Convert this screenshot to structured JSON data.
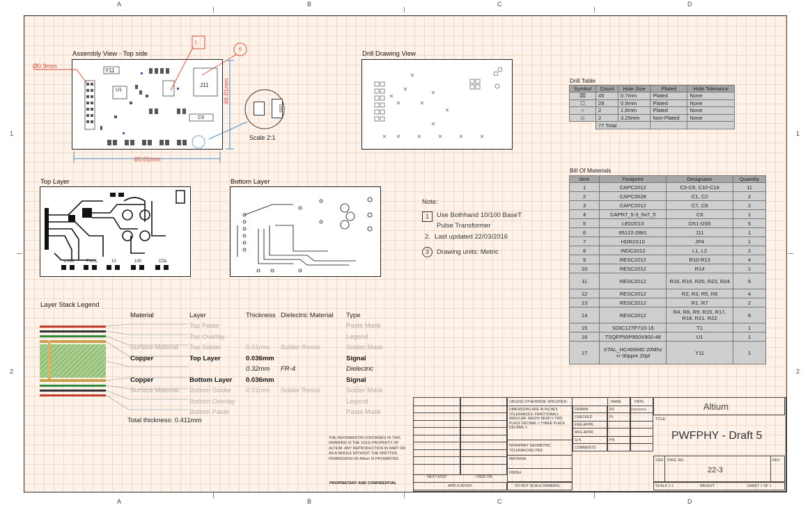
{
  "zones": {
    "letters": [
      "A",
      "B",
      "C",
      "D"
    ],
    "numbers": [
      "1",
      "2"
    ]
  },
  "views": {
    "assembly_title": "Assembly View - Top side",
    "drill_drawing_title": "Drill Drawing View",
    "top_layer_title": "Top Layer",
    "bottom_layer_title": "Bottom Layer",
    "layer_stack_title": "Layer Stack Legend"
  },
  "assembly": {
    "hole_dim": "Ø0.9mm",
    "height_dim": "48.01mm",
    "width_dim": "80.01mm",
    "scale": "Scale 2:1",
    "callout_1": "1",
    "callout_6": "6",
    "labels": {
      "y11": "Y11",
      "u1": "U1",
      "j11": "J11",
      "c9": "C9"
    },
    "detail_label": "DS5"
  },
  "top_layer_labels": [
    "LINK",
    "FULL",
    "10",
    "100",
    "COL"
  ],
  "note": {
    "title": "Note:",
    "items": [
      {
        "marker": "1",
        "text_line1": "Use Bothhand 10/100 BaseT",
        "text_line2": "Pulse Transformer"
      },
      {
        "marker": "2.",
        "text_line1": "Last updated 22/03/2016"
      },
      {
        "marker": "3",
        "text_line1": "Drawing units: Metric"
      }
    ]
  },
  "drill_table": {
    "title": "Drill Table",
    "headers": [
      "Symbol",
      "Count",
      "Hole Size",
      "Plated",
      "Hole Tolerance"
    ],
    "rows": [
      [
        "⌧",
        "45",
        "0.7mm",
        "Plated",
        "None"
      ],
      [
        "☐",
        "28",
        "0.9mm",
        "Plated",
        "None"
      ],
      [
        "○",
        "2",
        "1.6mm",
        "Plated",
        "None"
      ],
      [
        "◇",
        "2",
        "3.25mm",
        "Non-Plated",
        "None"
      ]
    ],
    "total": "77 Total"
  },
  "bom": {
    "title": "Bill Of Materials",
    "headers": [
      "Item",
      "Footprint",
      "Designator",
      "Quantity"
    ],
    "rows": [
      [
        "1",
        "CAPC2012",
        "C3-C6, C10-C16",
        "11"
      ],
      [
        "2",
        "CAPC3528",
        "C1, C2",
        "2"
      ],
      [
        "3",
        "CAPC2012",
        "C7, C8",
        "2"
      ],
      [
        "4",
        "CAPR7_5-3_6x7_5",
        "C9",
        "1"
      ],
      [
        "5",
        "LED2013",
        "DS1-DS5",
        "5"
      ],
      [
        "6",
        "95122-2881",
        "J11",
        "1"
      ],
      [
        "7",
        "HDR2X10",
        "JP4",
        "1"
      ],
      [
        "8",
        "INDC2012",
        "L1, L2",
        "2"
      ],
      [
        "9",
        "RESC2012",
        "R10-R13",
        "4"
      ],
      [
        "10",
        "RESC2012",
        "R14",
        "1"
      ],
      [
        "11",
        "RESC2012",
        "R16, R19, R20, R23, R24",
        "5"
      ],
      [
        "12",
        "RESC2012",
        "R2, R3, R5, R6",
        "4"
      ],
      [
        "13",
        "RESC2012",
        "R1, R7",
        "2"
      ],
      [
        "14",
        "RESC2012",
        "R4, R8, R9, R15, R17, R18, R21, R22",
        "8"
      ],
      [
        "15",
        "SOIC127P710-16",
        "T1",
        "1"
      ],
      [
        "16",
        "TSQFP50P900X900-48",
        "U1",
        "1"
      ],
      [
        "17",
        "XTAL_HC49SMD 20Mhz +/-30ppm 20pf",
        "Y11",
        "1"
      ]
    ]
  },
  "layer_stack": {
    "headers": {
      "material": "Material",
      "layer": "Layer",
      "thickness": "Thickness",
      "dielectric": "Dielectric Material",
      "type": "Type"
    },
    "rows": [
      {
        "material": "",
        "layer": "Top Paste",
        "thickness": "",
        "dielectric": "",
        "type": "Paste Mask",
        "style": "grey"
      },
      {
        "material": "",
        "layer": "Top Overlay",
        "thickness": "",
        "dielectric": "",
        "type": "Legend",
        "style": "grey"
      },
      {
        "material": "Surface Material",
        "layer": "Top Solder",
        "thickness": "0.01mm",
        "dielectric": "Solder Resist",
        "type": "Solder Mask",
        "style": "grey"
      },
      {
        "material": "Copper",
        "layer": "Top Layer",
        "thickness": "0.036mm",
        "dielectric": "",
        "type": "Signal",
        "style": "bold"
      },
      {
        "material": "",
        "layer": "",
        "thickness": "0.32mm",
        "dielectric": "FR-4",
        "type": "Dielectric",
        "style": "ital"
      },
      {
        "material": "Copper",
        "layer": "Bottom Layer",
        "thickness": "0.036mm",
        "dielectric": "",
        "type": "Signal",
        "style": "bold"
      },
      {
        "material": "Surface Material",
        "layer": "Bottom Solder",
        "thickness": "0.01mm",
        "dielectric": "Solder Resist",
        "type": "Solder Mask",
        "style": "grey"
      },
      {
        "material": "",
        "layer": "Bottom Overlay",
        "thickness": "",
        "dielectric": "",
        "type": "Legend",
        "style": "grey"
      },
      {
        "material": "",
        "layer": "Bottom Paste",
        "thickness": "",
        "dielectric": "",
        "type": "Paste Mask",
        "style": "grey"
      }
    ],
    "total": "Total thickness: 0.411mm"
  },
  "title_block": {
    "disclaimer": "THE INFORMATION CONTAINED IN THIS DRAWING IS THE SOLE PROPERTY OF ALTIUM. ANY REPRODUCTION IN PART OR AS A WHOLE WITHOUT THE WRITTEN PERMISSION OF Altium IS PROHIBITED.",
    "proprietary": "PROPRIETARY AND CONFIDENTIAL",
    "next_assy": "NEXT ASSY",
    "used_on": "USED ON",
    "application": "APPLICATION",
    "do_not_scale": "DO NOT SCALE DRAWING",
    "unless": "UNLESS OTHERWISE SPECIFIED:",
    "dimensions": "DIMENSIONS ARE IN INCHES TOLERANCES: FRACTIONAL± ANGULAR: MACH± BEND ± TWO PLACE DECIMAL ± THREE PLACE DECIMAL ±",
    "interpret": "INTERPRET GEOMETRIC TOLERANCING PER:",
    "material": "MATERIAL",
    "finish": "FINISH",
    "name_h": "NAME",
    "date_h": "DATE",
    "drawn": "DRAWN",
    "drawn_name": "RS",
    "drawn_date": "22/03/2016",
    "checked": "CHECKED",
    "checked_name": "PL",
    "eng_appr": "ENG APPR.",
    "mfg_appr": "MFG APPR.",
    "mfg_name": "-",
    "qa": "Q.A.",
    "qa_name": "PN",
    "comments": "COMMENTS:",
    "company": "Altium",
    "title_label": "TITLE:",
    "title": "PWFPHY - Draft 5",
    "size_label": "SIZE",
    "dwg_no_label": "DWG. NO.",
    "dwg_no": "22-3",
    "rev_label": "REV",
    "scale_label": "SCALE:",
    "scale": "1:1",
    "weight_label": "WEIGHT:",
    "sheet": "SHEET 1 OF 1"
  }
}
